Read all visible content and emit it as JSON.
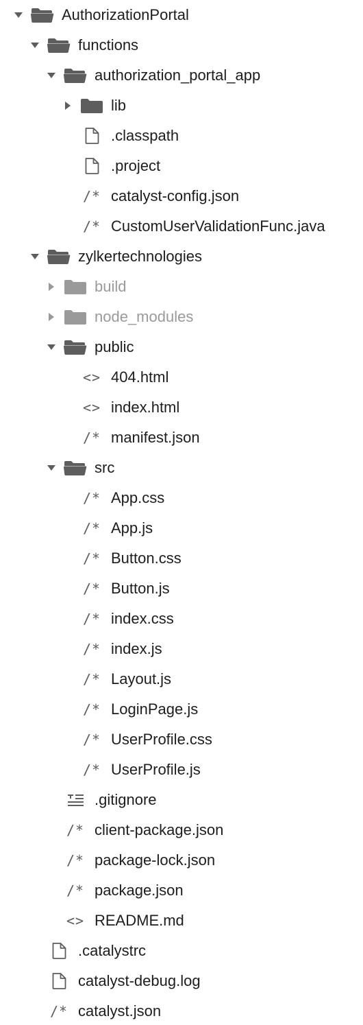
{
  "tree": [
    {
      "depth": 0,
      "kind": "folder",
      "open": true,
      "label": "AuthorizationPortal",
      "icon": "folder-open-icon"
    },
    {
      "depth": 1,
      "kind": "folder",
      "open": true,
      "label": "functions",
      "icon": "folder-open-icon"
    },
    {
      "depth": 2,
      "kind": "folder",
      "open": true,
      "label": "authorization_portal_app",
      "icon": "folder-open-icon"
    },
    {
      "depth": 3,
      "kind": "folder",
      "open": false,
      "label": "lib",
      "icon": "folder-icon"
    },
    {
      "depth": 3,
      "kind": "file",
      "label": ".classpath",
      "icon": "file-icon"
    },
    {
      "depth": 3,
      "kind": "file",
      "label": ".project",
      "icon": "file-icon"
    },
    {
      "depth": 3,
      "kind": "code",
      "label": "catalyst-config.json",
      "icon": "comment-code-icon",
      "glyph": "/*"
    },
    {
      "depth": 3,
      "kind": "code",
      "label": "CustomUserValidationFunc.java",
      "icon": "comment-code-icon",
      "glyph": "/*"
    },
    {
      "depth": 1,
      "kind": "folder",
      "open": true,
      "label": "zylkertechnologies",
      "icon": "folder-open-icon"
    },
    {
      "depth": 2,
      "kind": "folder",
      "open": false,
      "dim": true,
      "label": "build",
      "icon": "folder-icon"
    },
    {
      "depth": 2,
      "kind": "folder",
      "open": false,
      "dim": true,
      "label": "node_modules",
      "icon": "folder-icon"
    },
    {
      "depth": 2,
      "kind": "folder",
      "open": true,
      "label": "public",
      "icon": "folder-open-icon"
    },
    {
      "depth": 3,
      "kind": "code",
      "label": "404.html",
      "icon": "markup-icon",
      "glyph": "<>"
    },
    {
      "depth": 3,
      "kind": "code",
      "label": "index.html",
      "icon": "markup-icon",
      "glyph": "<>"
    },
    {
      "depth": 3,
      "kind": "code",
      "label": "manifest.json",
      "icon": "comment-code-icon",
      "glyph": "/*"
    },
    {
      "depth": 2,
      "kind": "folder",
      "open": true,
      "label": "src",
      "icon": "folder-open-icon"
    },
    {
      "depth": 3,
      "kind": "code",
      "label": "App.css",
      "icon": "comment-code-icon",
      "glyph": "/*"
    },
    {
      "depth": 3,
      "kind": "code",
      "label": "App.js",
      "icon": "comment-code-icon",
      "glyph": "/*"
    },
    {
      "depth": 3,
      "kind": "code",
      "label": "Button.css",
      "icon": "comment-code-icon",
      "glyph": "/*"
    },
    {
      "depth": 3,
      "kind": "code",
      "label": "Button.js",
      "icon": "comment-code-icon",
      "glyph": "/*"
    },
    {
      "depth": 3,
      "kind": "code",
      "label": "index.css",
      "icon": "comment-code-icon",
      "glyph": "/*"
    },
    {
      "depth": 3,
      "kind": "code",
      "label": "index.js",
      "icon": "comment-code-icon",
      "glyph": "/*"
    },
    {
      "depth": 3,
      "kind": "code",
      "label": "Layout.js",
      "icon": "comment-code-icon",
      "glyph": "/*"
    },
    {
      "depth": 3,
      "kind": "code",
      "label": "LoginPage.js",
      "icon": "comment-code-icon",
      "glyph": "/*"
    },
    {
      "depth": 3,
      "kind": "code",
      "label": "UserProfile.css",
      "icon": "comment-code-icon",
      "glyph": "/*"
    },
    {
      "depth": 3,
      "kind": "code",
      "label": "UserProfile.js",
      "icon": "comment-code-icon",
      "glyph": "/*"
    },
    {
      "depth": 2,
      "kind": "text",
      "label": ".gitignore",
      "icon": "text-lines-icon"
    },
    {
      "depth": 2,
      "kind": "code",
      "label": "client-package.json",
      "icon": "comment-code-icon",
      "glyph": "/*"
    },
    {
      "depth": 2,
      "kind": "code",
      "label": "package-lock.json",
      "icon": "comment-code-icon",
      "glyph": "/*"
    },
    {
      "depth": 2,
      "kind": "code",
      "label": "package.json",
      "icon": "comment-code-icon",
      "glyph": "/*"
    },
    {
      "depth": 2,
      "kind": "code",
      "label": "README.md",
      "icon": "markup-icon",
      "glyph": "<>"
    },
    {
      "depth": 1,
      "kind": "file",
      "label": ".catalystrc",
      "icon": "file-icon"
    },
    {
      "depth": 1,
      "kind": "file",
      "label": "catalyst-debug.log",
      "icon": "file-icon"
    },
    {
      "depth": 1,
      "kind": "code",
      "label": "catalyst.json",
      "icon": "comment-code-icon",
      "glyph": "/*"
    }
  ],
  "colors": {
    "icon": "#5d5d5d",
    "icon_dim": "#9a9a9a",
    "text": "#1d1d1d",
    "text_dim": "#9a9a9a"
  }
}
